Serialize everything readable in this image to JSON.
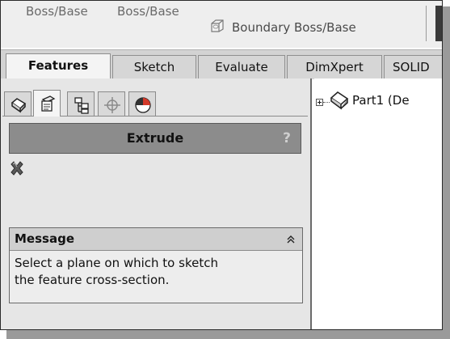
{
  "command_manager": {
    "buttons": [
      {
        "label": "Boss/Base"
      },
      {
        "label": "Boss/Base"
      },
      {
        "label": "Boundary Boss/Base",
        "icon": "boundary-boss-icon"
      }
    ]
  },
  "tabs": [
    {
      "label": "Features",
      "active": true
    },
    {
      "label": "Sketch",
      "active": false
    },
    {
      "label": "Evaluate",
      "active": false
    },
    {
      "label": "DimXpert",
      "active": false
    },
    {
      "label": "SOLID",
      "active": false
    }
  ],
  "panel_tabs": [
    {
      "icon": "feature-manager-icon",
      "active": false
    },
    {
      "icon": "property-manager-icon",
      "active": true
    },
    {
      "icon": "configuration-manager-icon",
      "active": false
    },
    {
      "icon": "dimxpert-manager-icon",
      "active": false
    },
    {
      "icon": "display-manager-icon",
      "active": false
    }
  ],
  "property_manager": {
    "title": "Extrude",
    "help_label": "?",
    "cancel_icon": "cancel-x-icon"
  },
  "message_box": {
    "heading": "Message",
    "collapse_glyph": "⌃⌃",
    "lines": [
      "Select a plane on which to sketch",
      "the feature cross-section."
    ]
  },
  "feature_tree": {
    "root_label": "Part1  (De",
    "root_icon": "part-icon"
  },
  "colors": {
    "header_gray": "#8c8c8c",
    "pane_bg": "#e6e6e6",
    "tab_active_bg": "#f4f4f4"
  }
}
